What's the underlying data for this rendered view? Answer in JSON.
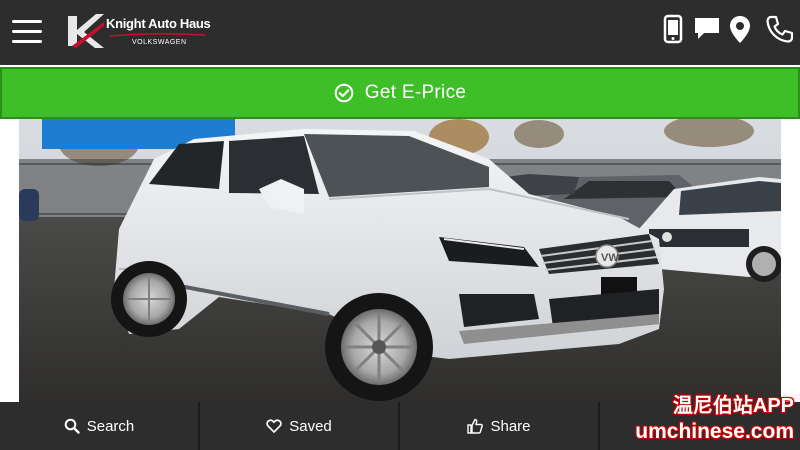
{
  "header": {
    "logo": {
      "name": "Knight Auto Haus",
      "subtitle": "VOLKSWAGEN"
    },
    "icons": [
      "mobile-phone-icon",
      "chat-icon",
      "map-pin-icon",
      "phone-icon"
    ]
  },
  "cta": {
    "label": "Get E-Price",
    "icon": "check-circle-icon",
    "color": "#3fbf27"
  },
  "hero": {
    "description": "white SUV photo"
  },
  "bottom_nav": [
    {
      "label": "Search",
      "icon": "search-icon"
    },
    {
      "label": "Saved",
      "icon": "heart-icon"
    },
    {
      "label": "Share",
      "icon": "thumbs-up-icon"
    },
    {
      "label": "",
      "icon": ""
    }
  ],
  "watermark": {
    "line1": "温尼伯站APP",
    "line2": "umchinese.com"
  }
}
